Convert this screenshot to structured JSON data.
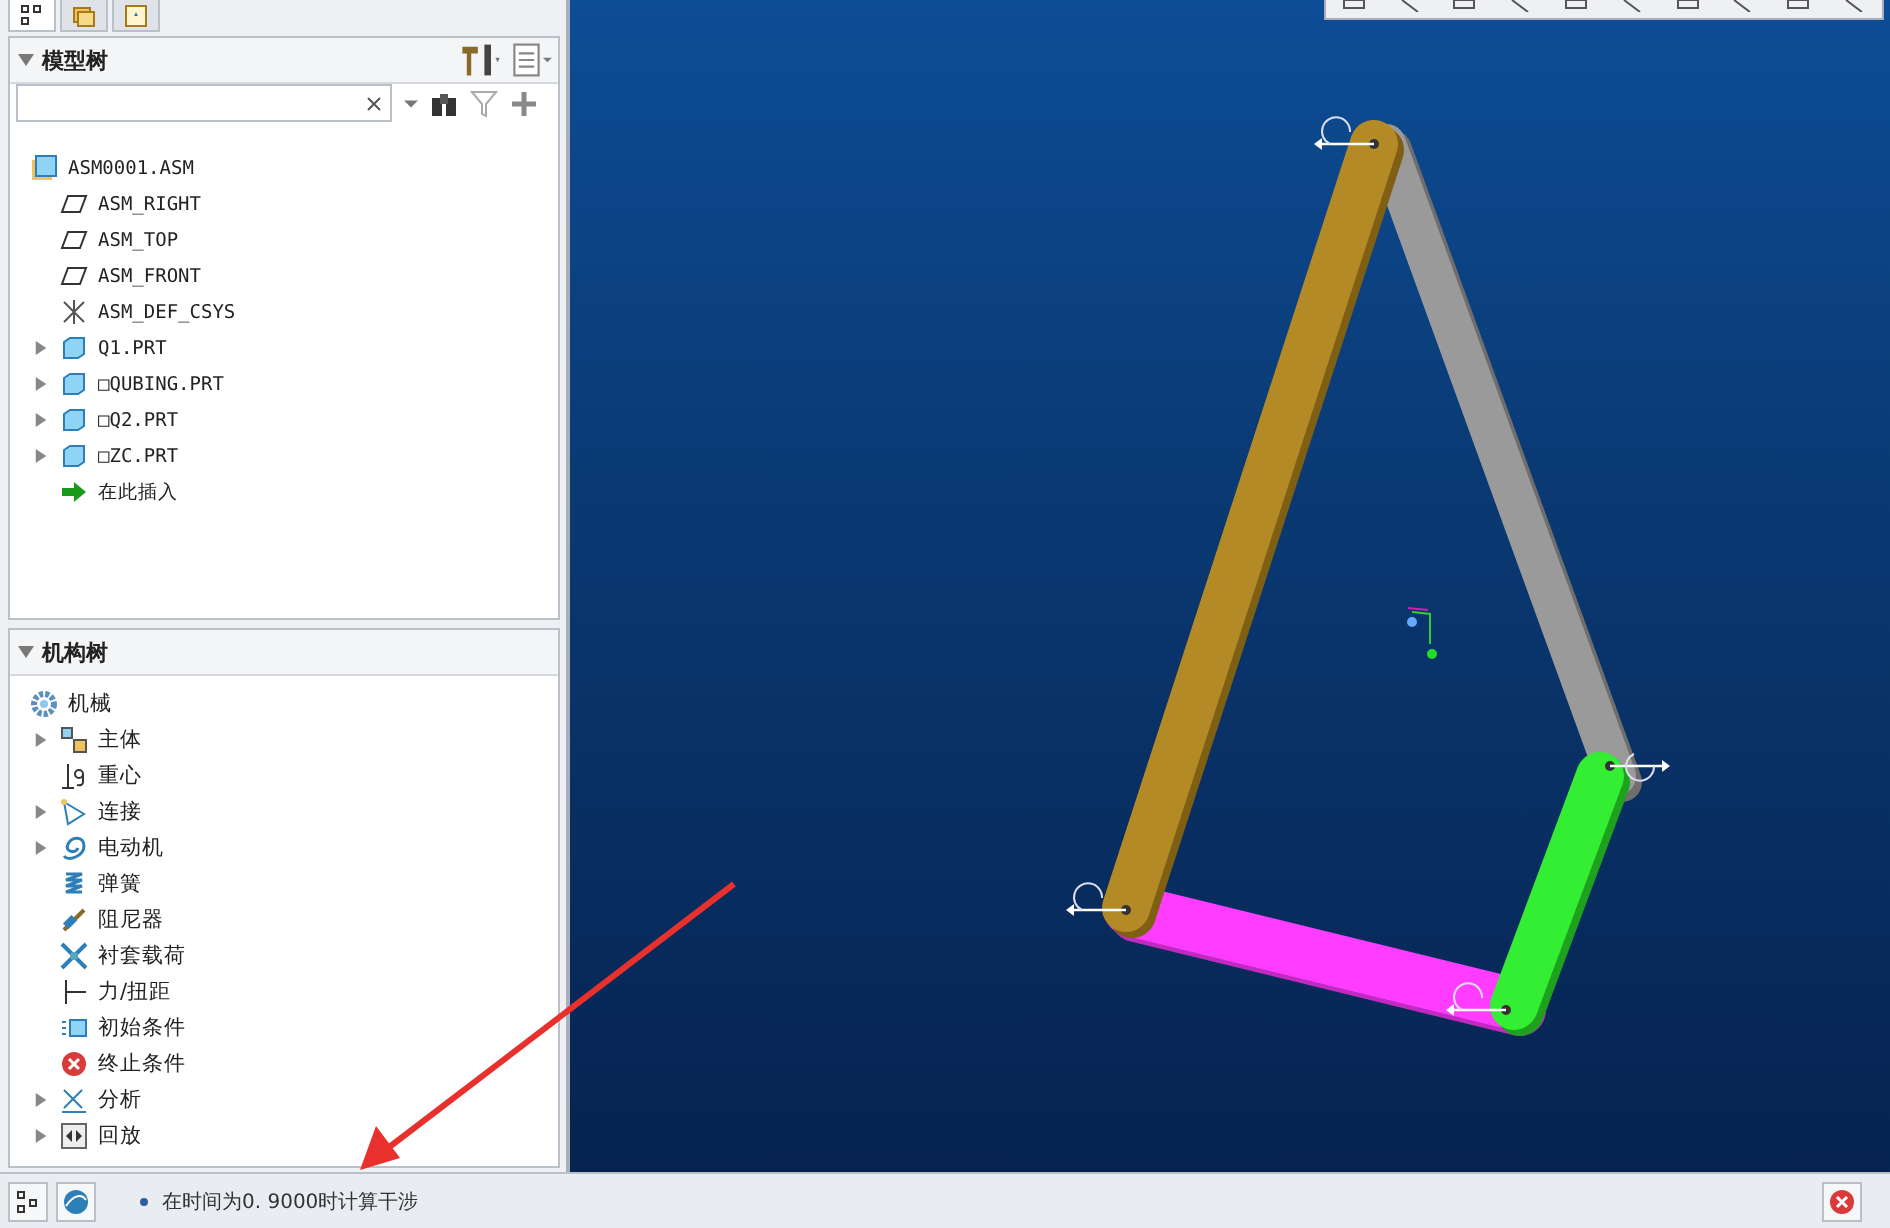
{
  "panel_tabs": [
    {
      "kind": "tree",
      "selected": true
    },
    {
      "kind": "folders",
      "selected": false
    },
    {
      "kind": "favorites",
      "selected": false
    }
  ],
  "model_tree": {
    "title": "模型树",
    "expanded": true,
    "items": [
      {
        "label": "ASM0001.ASM",
        "kind": "assembly"
      },
      {
        "label": "ASM_RIGHT",
        "kind": "plane"
      },
      {
        "label": "ASM_TOP",
        "kind": "plane"
      },
      {
        "label": "ASM_FRONT",
        "kind": "plane"
      },
      {
        "label": "ASM_DEF_CSYS",
        "kind": "csys"
      },
      {
        "label": "Q1.PRT",
        "kind": "part",
        "expanded": false
      },
      {
        "label": "□QUBING.PRT",
        "kind": "part",
        "expanded": false
      },
      {
        "label": "□Q2.PRT",
        "kind": "part",
        "expanded": false
      },
      {
        "label": "□ZC.PRT",
        "kind": "part",
        "expanded": false
      },
      {
        "label": "在此插入",
        "kind": "insert"
      }
    ]
  },
  "mechanism_tree": {
    "title": "机构树",
    "expanded": true,
    "items": [
      {
        "label": "机械",
        "kind": "gear"
      },
      {
        "label": "主体",
        "kind": "bodies",
        "expanded": false
      },
      {
        "label": "重心",
        "kind": "gravity"
      },
      {
        "label": "连接",
        "kind": "connections",
        "expanded": false
      },
      {
        "label": "电动机",
        "kind": "motor",
        "expanded": false
      },
      {
        "label": "弹簧",
        "kind": "spring"
      },
      {
        "label": "阻尼器",
        "kind": "damper"
      },
      {
        "label": "衬套载荷",
        "kind": "bushing"
      },
      {
        "label": "力/扭距",
        "kind": "force"
      },
      {
        "label": "初始条件",
        "kind": "initial"
      },
      {
        "label": "终止条件",
        "kind": "stop"
      },
      {
        "label": "分析",
        "kind": "analysis",
        "expanded": false
      },
      {
        "label": "回放",
        "kind": "playback",
        "expanded": false
      }
    ]
  },
  "status_bar": {
    "message": "在时间为0. 9000时计算干涉"
  }
}
